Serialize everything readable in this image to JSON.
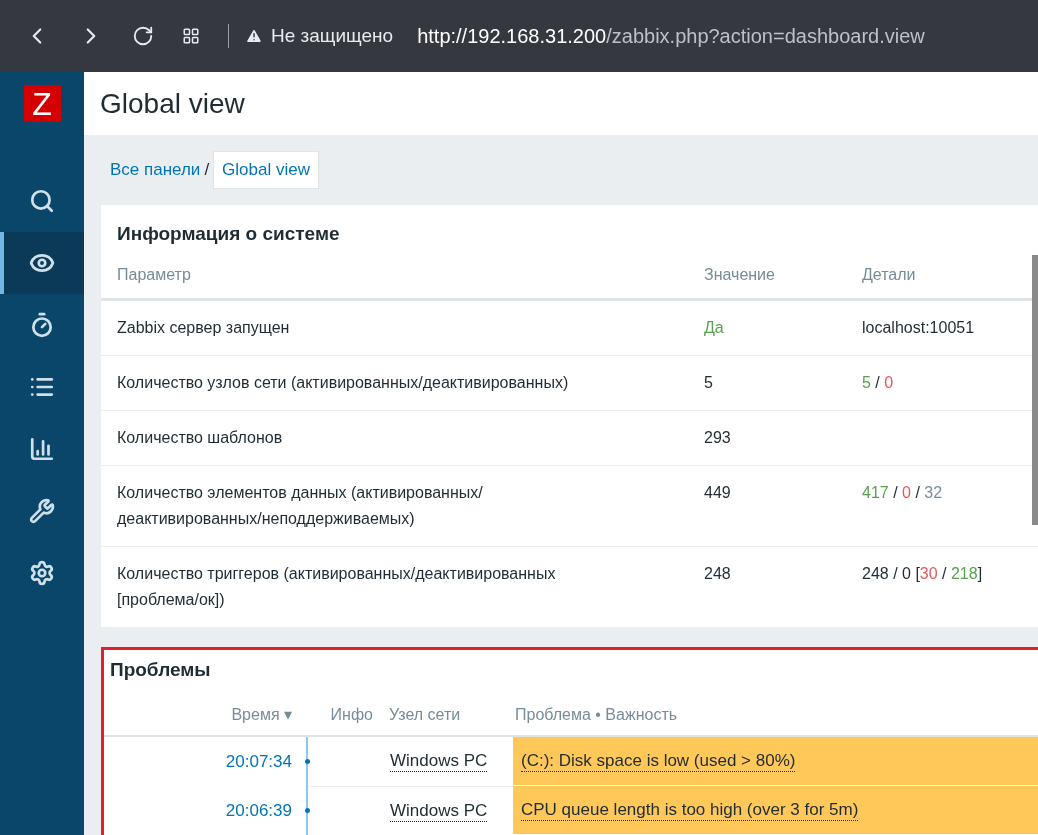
{
  "browser": {
    "security": "Не защищено",
    "url_host": "http://192.168.31.200",
    "url_path": "/zabbix.php?action=dashboard.view"
  },
  "sidebar": {
    "logo": "Z",
    "items": [
      {
        "kind": "search",
        "selected": false
      },
      {
        "kind": "eye",
        "selected": true
      },
      {
        "kind": "stopwatch",
        "selected": false
      },
      {
        "kind": "list",
        "selected": false
      },
      {
        "kind": "chart",
        "selected": false
      },
      {
        "kind": "wrench",
        "selected": false
      },
      {
        "kind": "gear",
        "selected": false
      }
    ]
  },
  "page_title": "Global view",
  "breadcrumb": [
    {
      "label": "Все панели",
      "selected": false
    },
    {
      "label": "Global view",
      "selected": true
    }
  ],
  "breadcrumb_separator": "/",
  "system_info": {
    "title": "Информация о системе",
    "columns": [
      "Параметр",
      "Значение",
      "Детали"
    ],
    "rows": [
      {
        "parameter": "Zabbix сервер запущен",
        "value": {
          "text": "Да",
          "color": "#59a14f"
        },
        "details": [
          {
            "text": "localhost:10051",
            "color": "#1f2c33"
          }
        ]
      },
      {
        "parameter": "Количество узлов сети (активированных/деактивированных)",
        "value": {
          "text": "5",
          "color": "#1f2c33"
        },
        "details": [
          {
            "text": "5",
            "color": "#59a14f"
          },
          {
            "text": " / ",
            "color": "#1f2c33"
          },
          {
            "text": "0",
            "color": "#e45959"
          }
        ]
      },
      {
        "parameter": "Количество шаблонов",
        "value": {
          "text": "293",
          "color": "#1f2c33"
        },
        "details": []
      },
      {
        "parameter": "Количество элементов данных (активированных/ деактивированных/неподдерживаемых)",
        "value": {
          "text": "449",
          "color": "#1f2c33"
        },
        "details": [
          {
            "text": "417",
            "color": "#59a14f"
          },
          {
            "text": " / ",
            "color": "#1f2c33"
          },
          {
            "text": "0",
            "color": "#e45959"
          },
          {
            "text": " / ",
            "color": "#1f2c33"
          },
          {
            "text": "32",
            "color": "#768d99"
          }
        ]
      },
      {
        "parameter": "Количество триггеров (активированных/деактивированных [проблема/ок])",
        "value": {
          "text": "248",
          "color": "#1f2c33"
        },
        "details": [
          {
            "text": "248 / 0 [",
            "color": "#1f2c33"
          },
          {
            "text": "30",
            "color": "#e45959"
          },
          {
            "text": " / ",
            "color": "#1f2c33"
          },
          {
            "text": "218",
            "color": "#59a14f"
          },
          {
            "text": "]",
            "color": "#1f2c33"
          }
        ]
      }
    ]
  },
  "problems": {
    "title": "Проблемы",
    "columns": [
      "Время ▾",
      "Инфо",
      "Узел сети",
      "Проблема • Важность"
    ],
    "rows": [
      {
        "time": "20:07:34",
        "host": "Windows PC",
        "problem": "(C:): Disk space is low (used > 80%)",
        "color": "#ffc859"
      },
      {
        "time": "20:06:39",
        "host": "Windows PC",
        "problem": "CPU queue length is too high (over 3 for 5m)",
        "color": "#ffc859"
      }
    ]
  }
}
